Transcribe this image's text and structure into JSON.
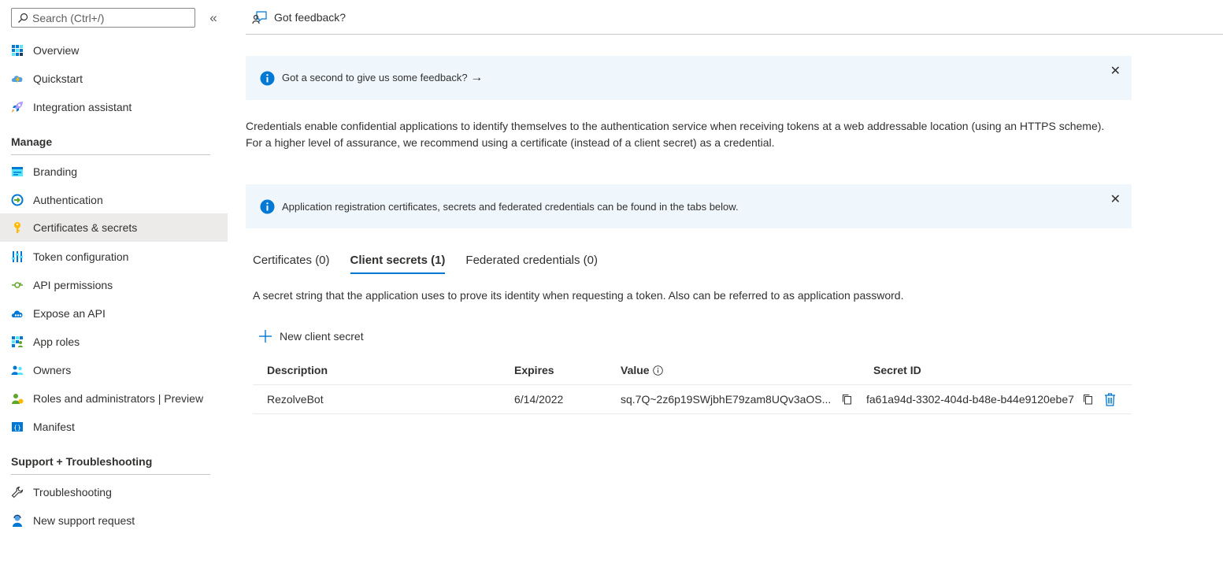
{
  "sidebar": {
    "search_placeholder": "Search (Ctrl+/)",
    "collapse_glyph": "«",
    "items_top": [
      {
        "label": "Overview",
        "icon": "overview-icon"
      },
      {
        "label": "Quickstart",
        "icon": "quickstart-icon"
      },
      {
        "label": "Integration assistant",
        "icon": "rocket-icon"
      }
    ],
    "manage_heading": "Manage",
    "items_manage": [
      {
        "label": "Branding",
        "icon": "branding-icon"
      },
      {
        "label": "Authentication",
        "icon": "authentication-icon"
      },
      {
        "label": "Certificates & secrets",
        "icon": "key-icon",
        "selected": true
      },
      {
        "label": "Token configuration",
        "icon": "token-icon"
      },
      {
        "label": "API permissions",
        "icon": "api-permissions-icon"
      },
      {
        "label": "Expose an API",
        "icon": "cloud-icon"
      },
      {
        "label": "App roles",
        "icon": "app-roles-icon"
      },
      {
        "label": "Owners",
        "icon": "owners-icon"
      },
      {
        "label": "Roles and administrators | Preview",
        "icon": "roles-icon"
      },
      {
        "label": "Manifest",
        "icon": "manifest-icon"
      }
    ],
    "support_heading": "Support + Troubleshooting",
    "items_support": [
      {
        "label": "Troubleshooting",
        "icon": "wrench-icon"
      },
      {
        "label": "New support request",
        "icon": "support-person-icon"
      }
    ]
  },
  "toolbar": {
    "feedback_label": "Got feedback?"
  },
  "banners": {
    "feedback_text": "Got a second to give us some feedback?",
    "feedback_arrow": "→",
    "info_text": "Application registration certificates, secrets and federated credentials can be found in the tabs below.",
    "close_glyph": "✕"
  },
  "description": "Credentials enable confidential applications to identify themselves to the authentication service when receiving tokens at a web addressable location (using an HTTPS scheme). For a higher level of assurance, we recommend using a certificate (instead of a client secret) as a credential.",
  "tabs": [
    {
      "label": "Certificates (0)",
      "active": false
    },
    {
      "label": "Client secrets (1)",
      "active": true
    },
    {
      "label": "Federated credentials (0)",
      "active": false
    }
  ],
  "tab_description": "A secret string that the application uses to prove its identity when requesting a token. Also can be referred to as application password.",
  "new_secret_label": "New client secret",
  "table": {
    "headers": {
      "description": "Description",
      "expires": "Expires",
      "value": "Value",
      "secret_id": "Secret ID"
    },
    "rows": [
      {
        "description": "RezolveBot",
        "expires": "6/14/2022",
        "value": "sq.7Q~2z6p19SWjbhE79zam8UQv3aOS...",
        "secret_id": "fa61a94d-3302-404d-b48e-b44e9120ebe7"
      }
    ]
  },
  "colors": {
    "accent": "#0078d4",
    "selected_bg": "#edebe9",
    "banner_bg": "#eff6fc"
  }
}
